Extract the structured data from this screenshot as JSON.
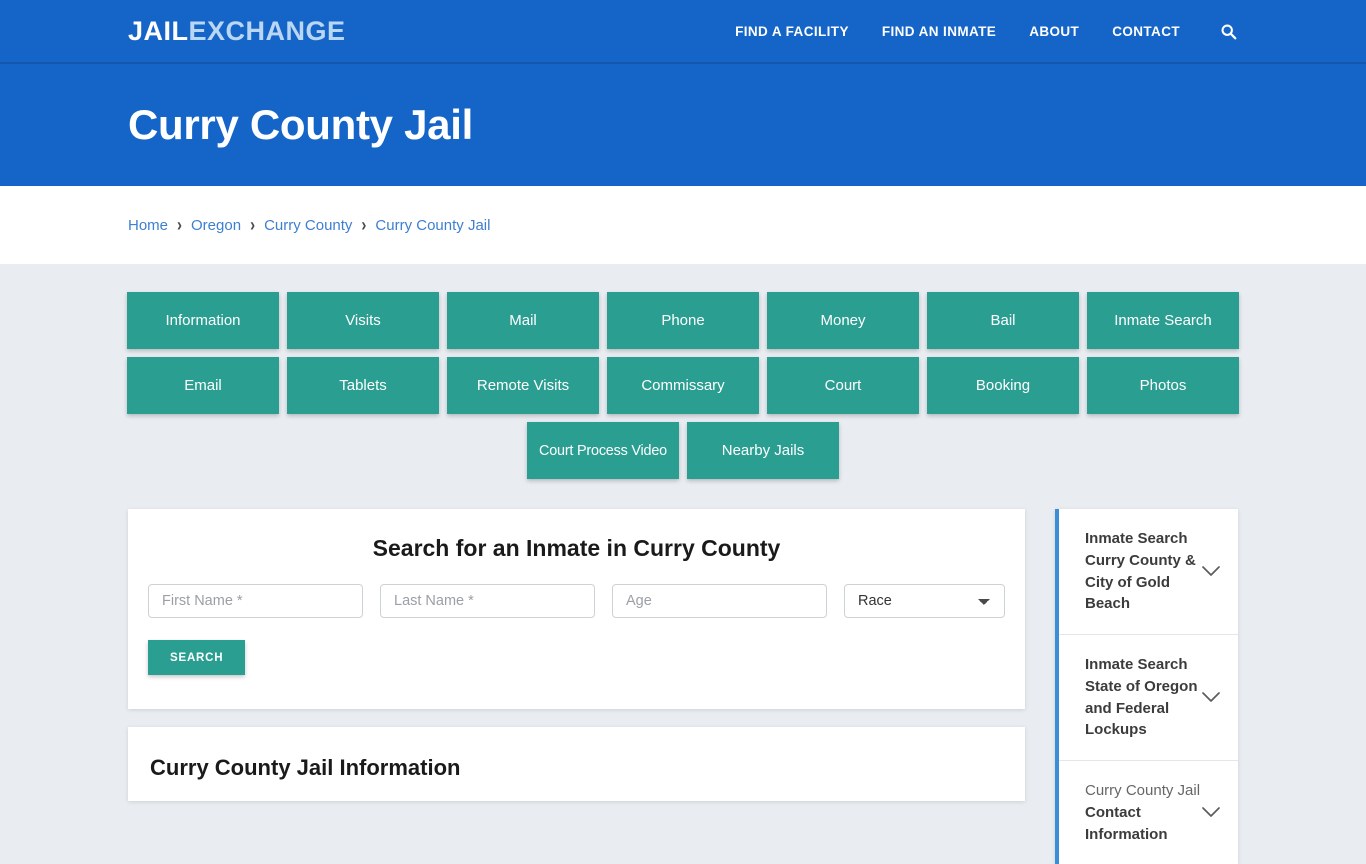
{
  "header": {
    "logo_primary": "JAIL",
    "logo_secondary": "EXCHANGE",
    "nav": [
      {
        "label": "FIND A FACILITY"
      },
      {
        "label": "FIND AN INMATE"
      },
      {
        "label": "ABOUT"
      },
      {
        "label": "CONTACT"
      }
    ],
    "search_icon": "search-icon",
    "brand_color": "#1565c8"
  },
  "page_title": "Curry County Jail",
  "breadcrumb": {
    "separator": "›",
    "items": [
      {
        "label": "Home"
      },
      {
        "label": "Oregon"
      },
      {
        "label": "Curry County"
      },
      {
        "label": "Curry County Jail"
      }
    ]
  },
  "tiles": {
    "accent_color": "#2b9e92",
    "row1": [
      {
        "label": "Information"
      },
      {
        "label": "Visits"
      },
      {
        "label": "Mail"
      },
      {
        "label": "Phone"
      },
      {
        "label": "Money"
      },
      {
        "label": "Bail"
      },
      {
        "label": "Inmate Search"
      }
    ],
    "row2": [
      {
        "label": "Email"
      },
      {
        "label": "Tablets"
      },
      {
        "label": "Remote Visits"
      },
      {
        "label": "Commissary"
      },
      {
        "label": "Court"
      },
      {
        "label": "Booking"
      },
      {
        "label": "Photos"
      }
    ],
    "row3": [
      {
        "label": "Court Process Video"
      },
      {
        "label": "Nearby Jails"
      }
    ]
  },
  "search_form": {
    "heading": "Search for an Inmate in Curry County",
    "first_name_placeholder": "First Name *",
    "first_name_value": "",
    "last_name_placeholder": "Last Name *",
    "last_name_value": "",
    "age_placeholder": "Age",
    "age_value": "",
    "race_selected": "Race",
    "race_options": [
      "Race"
    ],
    "submit_label": "SEARCH"
  },
  "info_card": {
    "heading": "Curry County Jail Information"
  },
  "sidebar": {
    "border_color": "#3a8ed8",
    "items": [
      {
        "line1": "Inmate Search",
        "line2": "Curry County & City of Gold Beach",
        "style": "bold",
        "chevron": "chevron-down-icon"
      },
      {
        "line1": "Inmate Search",
        "line2": "State of Oregon and Federal Lockups",
        "style": "bold",
        "chevron": "chevron-down-icon"
      },
      {
        "line1": "Curry County Jail",
        "line2": "Contact Information",
        "style": "light",
        "chevron": "chevron-down-icon"
      }
    ]
  }
}
